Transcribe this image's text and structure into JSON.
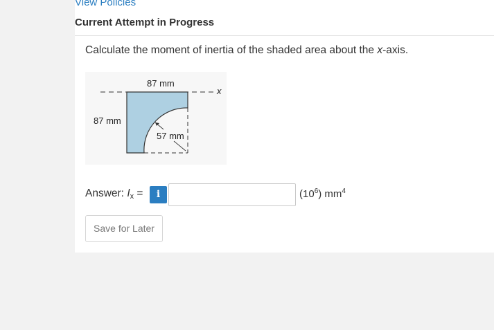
{
  "header": {
    "view_policies": "View Policies",
    "section_title": "Current Attempt in Progress"
  },
  "question": {
    "text_before": "Calculate the moment of inertia of the shaded area about the ",
    "axis_var": "x",
    "text_after": "-axis."
  },
  "figure": {
    "width_label": "87 mm",
    "height_label": "87 mm",
    "radius_label": "57 mm",
    "axis_label": "x",
    "colors": {
      "shade": "#aed0e2",
      "outline": "#333333"
    }
  },
  "answer": {
    "label_prefix": "Answer: ",
    "var": "I",
    "var_sub": "x",
    "equals": " =",
    "info_icon": "i",
    "input_value": "",
    "unit_prefix": "(10",
    "unit_exp": "6",
    "unit_mid": ") mm",
    "unit_pow": "4"
  },
  "actions": {
    "save_label": "Save for Later"
  },
  "colors": {
    "link": "#2b7ec1",
    "info_button": "#2b7ec1",
    "background": "#f2f2f2"
  }
}
